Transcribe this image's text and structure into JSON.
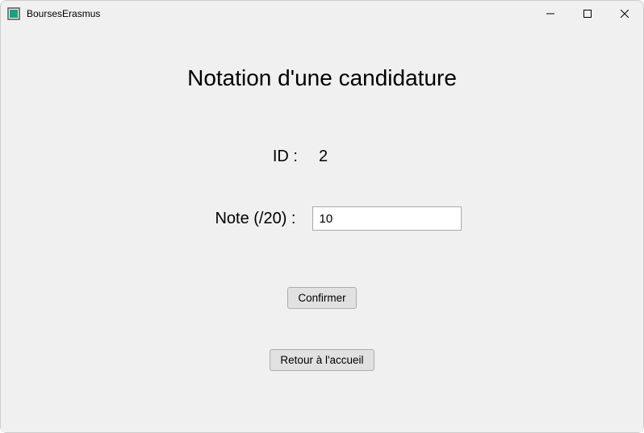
{
  "window": {
    "title": "BoursesErasmus"
  },
  "page": {
    "title": "Notation d'une candidature"
  },
  "form": {
    "id_label": "ID :",
    "id_value": "2",
    "note_label": "Note (/20) :",
    "note_value": "10"
  },
  "buttons": {
    "confirm": "Confirmer",
    "back": "Retour à l'accueil"
  }
}
